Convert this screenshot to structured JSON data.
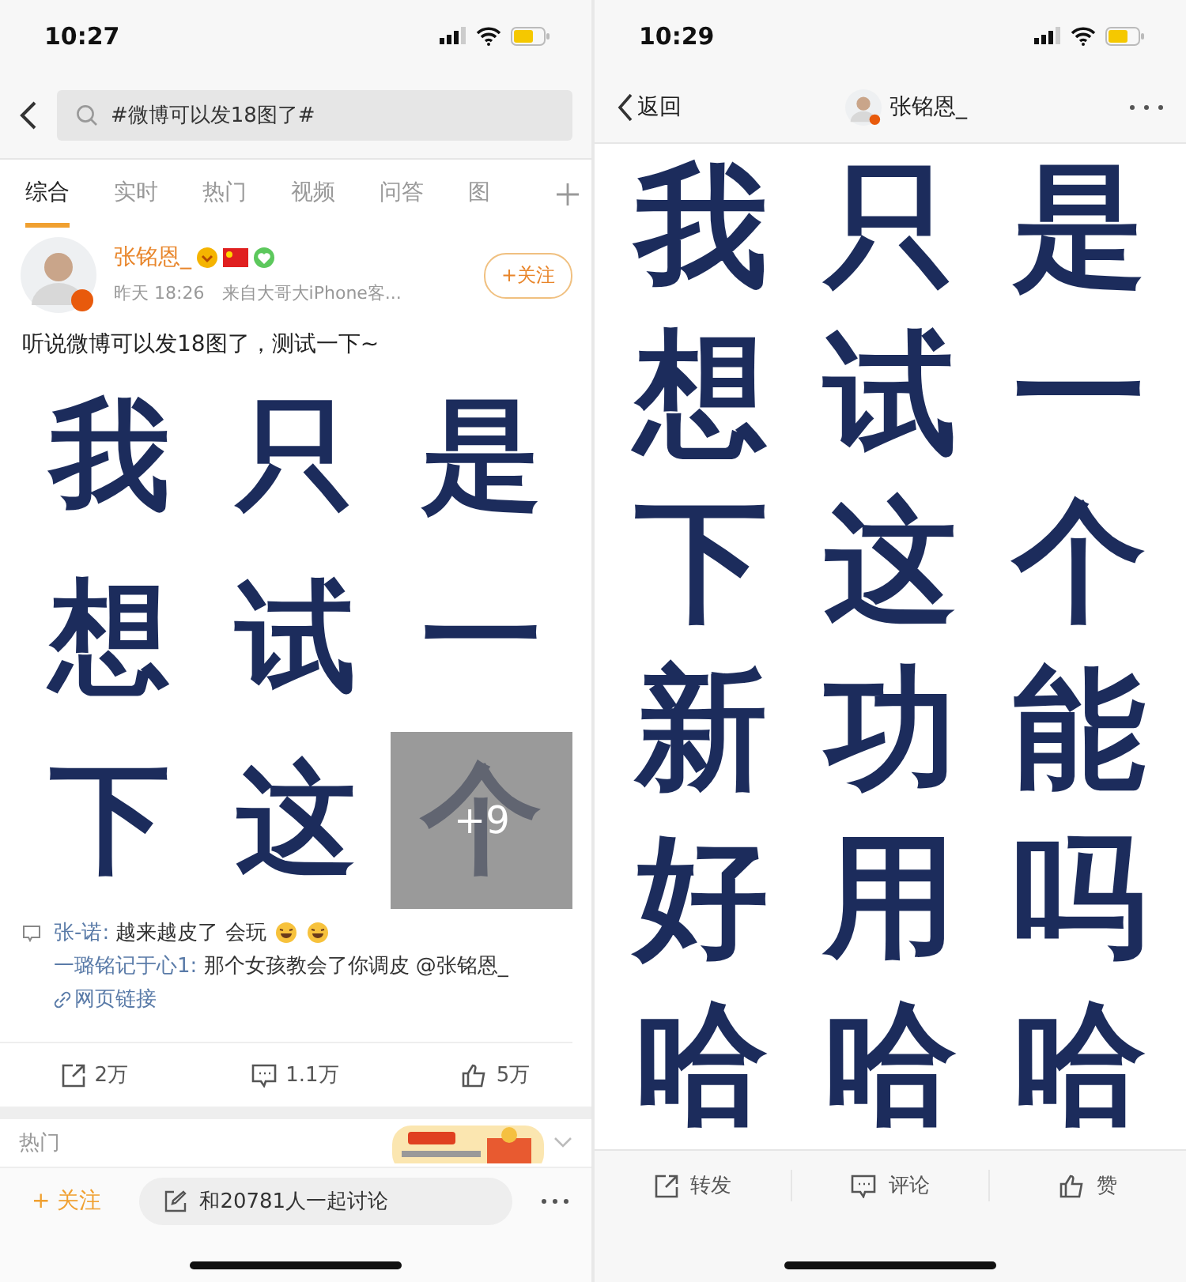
{
  "left_screen": {
    "status_bar": {
      "time": "10:27"
    },
    "search": {
      "value": "#微博可以发18图了#"
    },
    "tabs": [
      {
        "label": "综合",
        "selected": true
      },
      {
        "label": "实时",
        "selected": false
      },
      {
        "label": "热门",
        "selected": false
      },
      {
        "label": "视频",
        "selected": false
      },
      {
        "label": "问答",
        "selected": false
      },
      {
        "label": "图",
        "selected": false
      }
    ],
    "post": {
      "author": "张铭恩_",
      "time": "昨天 18:26",
      "source": "来自大哥大iPhone客...",
      "follow_button": "+关注",
      "text": "听说微博可以发18图了，测试一下~",
      "images": [
        "我",
        "只",
        "是",
        "想",
        "试",
        "一",
        "下",
        "这",
        "个"
      ],
      "more_count": "+9",
      "comments": [
        {
          "user": "张-诺:",
          "text": "越来越皮了 会玩",
          "emojis": [
            {
              "kind": "laughing"
            },
            {
              "kind": "laughing"
            }
          ]
        },
        {
          "user": "一璐铭记于心1:",
          "text": "那个女孩教会了你调皮 @张铭恩_"
        }
      ],
      "link": "网页链接",
      "actions": [
        {
          "kind": "repost",
          "label": "2万"
        },
        {
          "kind": "comment",
          "label": "1.1万"
        },
        {
          "kind": "like",
          "label": "5万"
        }
      ]
    },
    "hot_section": {
      "label": "热门"
    },
    "bottom_bar": {
      "follow": "+ 关注",
      "discuss": "和20781人一起讨论"
    }
  },
  "right_screen": {
    "status_bar": {
      "time": "10:29"
    },
    "nav": {
      "back": "返回",
      "title": "张铭恩_"
    },
    "images": [
      "我",
      "只",
      "是",
      "想",
      "试",
      "一",
      "下",
      "这",
      "个",
      "新",
      "功",
      "能",
      "好",
      "用",
      "吗",
      "哈",
      "哈",
      "哈"
    ],
    "actions": [
      {
        "kind": "repost",
        "label": "转发"
      },
      {
        "kind": "comment",
        "label": "评论"
      },
      {
        "kind": "like",
        "label": "赞"
      }
    ]
  }
}
